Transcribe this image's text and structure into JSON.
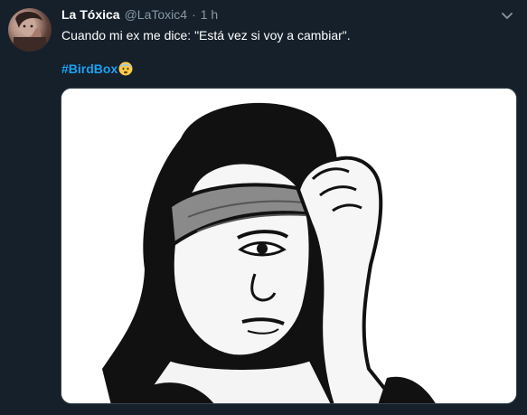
{
  "tweet": {
    "display_name": "La Tóxica",
    "handle": "@LaToxic4",
    "separator": "·",
    "time": "1 h",
    "text": "Cuando mi ex me dice: \"Está vez si voy a cambiar\".",
    "hashtag": "#BirdBox",
    "emoji": "fearful-face-emoji",
    "avatar_icon": "user-avatar",
    "menu_icon": "chevron-down-icon",
    "media_icon": "meme-image"
  },
  "colors": {
    "background": "#15202b",
    "secondary_text": "#8899a6",
    "link": "#1da1f2",
    "primary_text": "#ffffff"
  }
}
